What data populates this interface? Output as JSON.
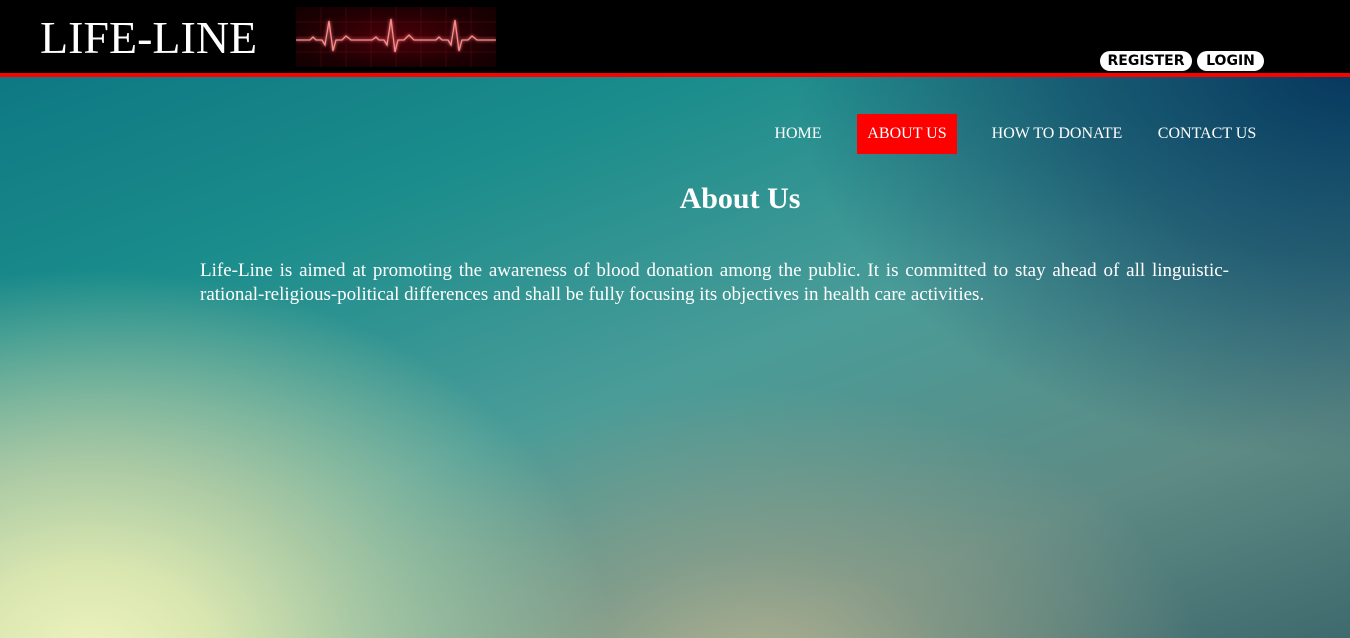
{
  "header": {
    "logo_text": "LIFE-LINE",
    "logo_graphic": "ecg-heartbeat-icon",
    "register_label": "REGISTER",
    "login_label": "LOGIN",
    "accent_color": "#ff0000",
    "bar_color": "#000000"
  },
  "nav": {
    "items": [
      {
        "label": "HOME",
        "active": false
      },
      {
        "label": "ABOUT US",
        "active": true
      },
      {
        "label": "HOW TO DONATE",
        "active": false
      },
      {
        "label": "CONTACT US",
        "active": false
      }
    ],
    "active_color": "#ff0000"
  },
  "main": {
    "title": "About Us",
    "paragraph": "Life-Line is aimed at promoting the awareness of blood donation among the public. It is committed to stay ahead of all linguistic-rational-religious-political differences and shall be fully focusing its objectives in health care activities."
  }
}
